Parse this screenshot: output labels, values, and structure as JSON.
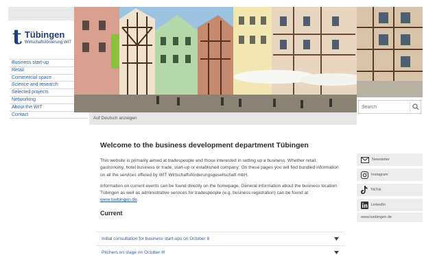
{
  "logo": {
    "mark": "t",
    "title": "Tübingen",
    "subtitle": "Wirtschaftsförderung WIT"
  },
  "nav": [
    {
      "label": "Business start-up"
    },
    {
      "label": "Retail"
    },
    {
      "label": "Commercial space"
    },
    {
      "label": "Science and research"
    },
    {
      "label": "Selected projects"
    },
    {
      "label": "Networking"
    },
    {
      "label": "About the WIT"
    },
    {
      "label": "Contact"
    }
  ],
  "hero": {
    "caption": "Auf Deutsch anzeigen"
  },
  "search": {
    "placeholder": "Search"
  },
  "main": {
    "title": "Welcome to the business development department Tübingen",
    "paragraph1": "This website is primarily aimed at tradespeople and those interested in setting up a business. Whether retail, gastronomy, hotel business or trade, start-up or established company: On these pages you will find bundled information on all the services offered by WIT Wirtschaftsförderungsgesellschaft mbH.",
    "paragraph2": "Information on current events can be found directly on the homepage. General information about the business location Tübingen as well as administrative services for tradespeople (e.g. business registration) can be found at",
    "paragraph2_link": "www.tuebingen.de",
    "paragraph2_end": ".",
    "current_title": "Current",
    "accordion": [
      {
        "label": "Initial consultation for business start-ups on October 8"
      },
      {
        "label": "Pitchers on stage on October 8!"
      }
    ]
  },
  "social": [
    {
      "label": "Newsletter",
      "icon": "envelope-icon"
    },
    {
      "label": "Instagram",
      "icon": "instagram-icon"
    },
    {
      "label": "TikTok",
      "icon": "tiktok-icon"
    },
    {
      "label": "LinkedIn",
      "icon": "linkedin-icon"
    },
    {
      "label": "www.tuebingen.de",
      "icon": ""
    }
  ],
  "colors": {
    "brand": "#1f3f78",
    "link": "#2a5d9f",
    "panel": "#ececec"
  }
}
